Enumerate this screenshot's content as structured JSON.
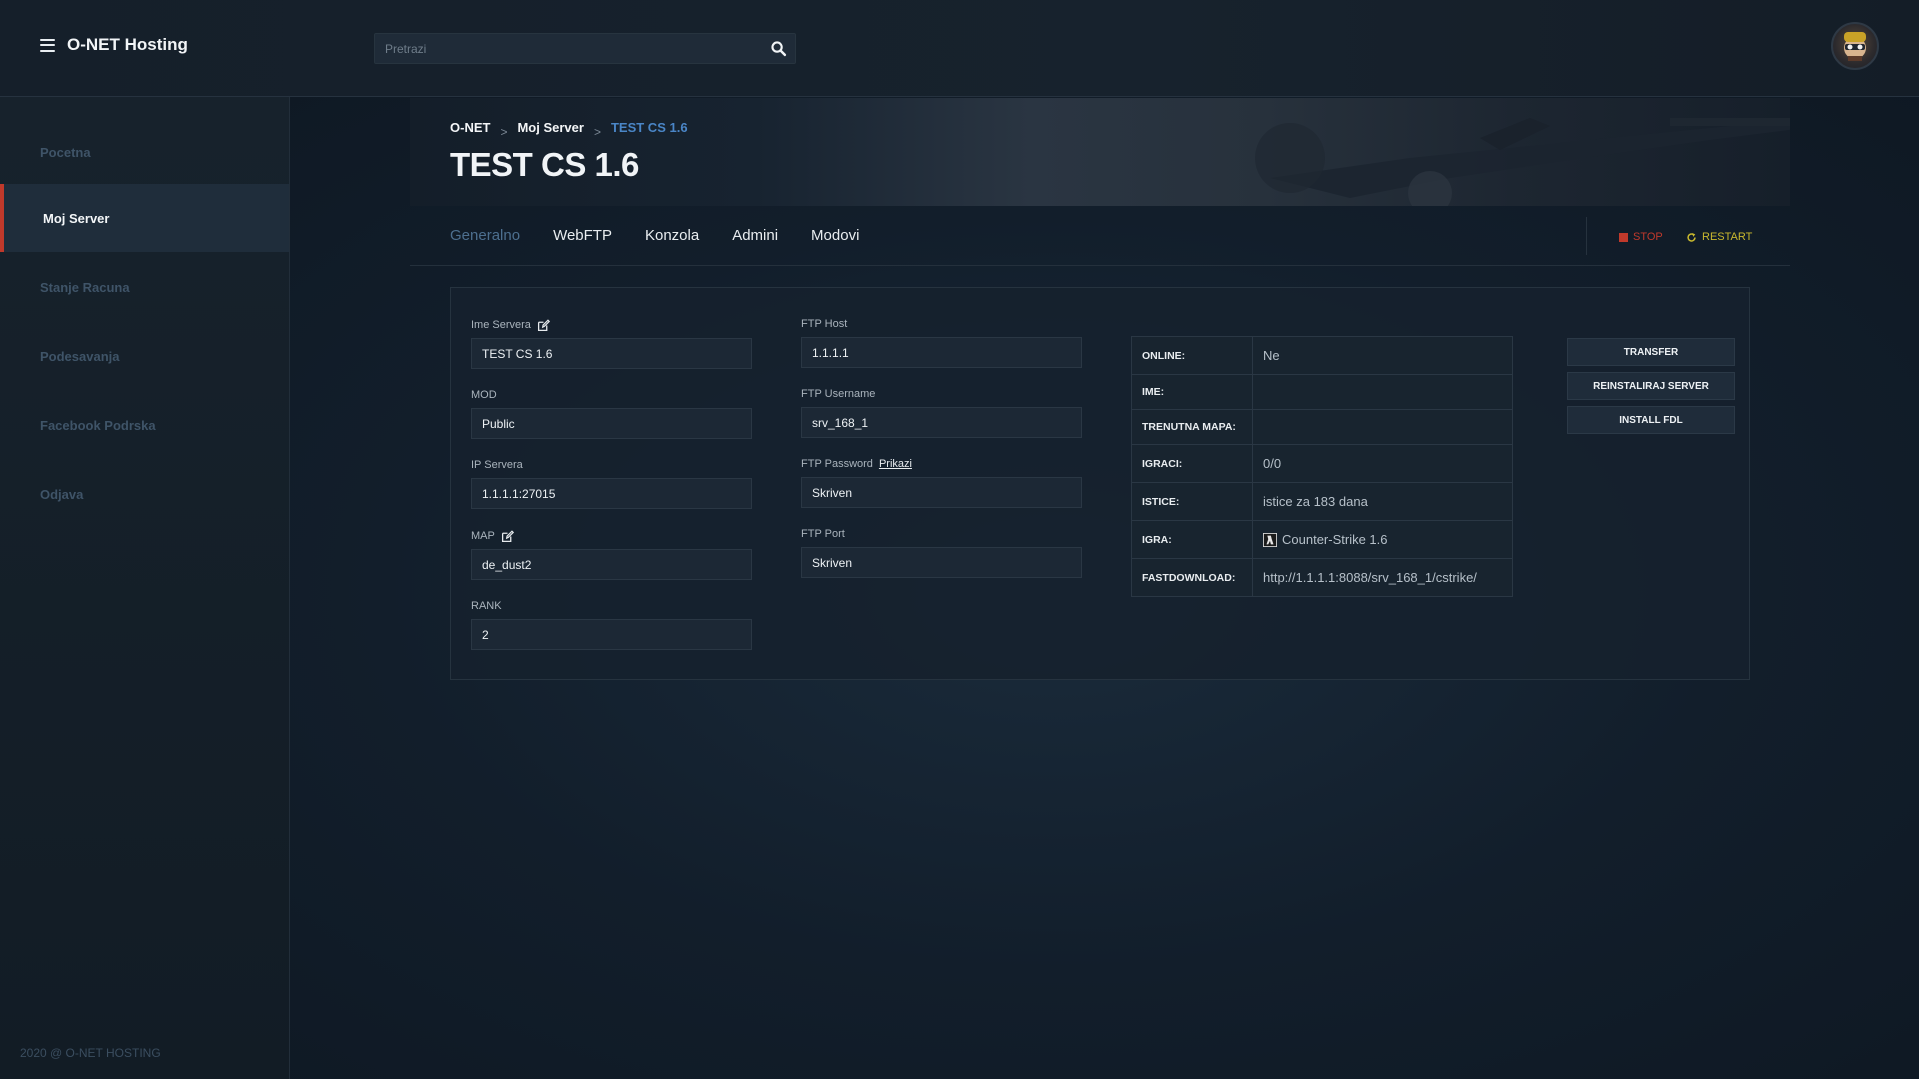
{
  "app": {
    "title": "O-NET Hosting"
  },
  "search": {
    "placeholder": "Pretrazi"
  },
  "sidebar": {
    "items": [
      {
        "label": "Pocetna"
      },
      {
        "label": "Moj Server"
      },
      {
        "label": "Stanje Racuna"
      },
      {
        "label": "Podesavanja"
      },
      {
        "label": "Facebook Podrska"
      },
      {
        "label": "Odjava"
      }
    ],
    "active_index": 1,
    "footer": "2020 @ O-NET HOSTING"
  },
  "breadcrumb": [
    "O-NET",
    "Moj Server",
    "TEST CS 1.6"
  ],
  "page": {
    "title": "TEST CS 1.6"
  },
  "tabs": [
    {
      "label": "Generalno"
    },
    {
      "label": "WebFTP"
    },
    {
      "label": "Konzola"
    },
    {
      "label": "Admini"
    },
    {
      "label": "Modovi"
    }
  ],
  "active_tab": 0,
  "actions": {
    "stop": "STOP",
    "restart": "RESTART"
  },
  "server": {
    "name_label": "Ime Servera",
    "name": "TEST CS 1.6",
    "mod_label": "MOD",
    "mod": "Public",
    "ip_label": "IP Servera",
    "ip": "1.1.1.1:27015",
    "map_label": "MAP",
    "map": "de_dust2",
    "rank_label": "RANK",
    "rank": "2"
  },
  "ftp": {
    "host_label": "FTP Host",
    "host": "1.1.1.1",
    "username_label": "FTP Username",
    "username": "srv_168_1",
    "password_label": "FTP Password",
    "password_link": "Prikazi",
    "password": "Skriven",
    "port_label": "FTP Port",
    "port": "Skriven"
  },
  "info": [
    {
      "key": "ONLINE:",
      "value": "Ne"
    },
    {
      "key": "IME:",
      "value": ""
    },
    {
      "key": "TRENUTNA MAPA:",
      "value": ""
    },
    {
      "key": "IGRACI:",
      "value": "0/0"
    },
    {
      "key": "ISTICE:",
      "value": "istice za 183 dana"
    },
    {
      "key": "IGRA:",
      "value": "Counter-Strike 1.6"
    },
    {
      "key": "FASTDOWNLOAD:",
      "value": "http://1.1.1.1:8088/srv_168_1/cstrike/"
    }
  ],
  "buttons": {
    "transfer": "TRANSFER",
    "reinstall": "REINSTALIRAJ SERVER",
    "install_fdl": "INSTALL FDL"
  },
  "colors": {
    "accent_red": "#c0392b",
    "accent_yellow": "#c9b92e",
    "link_blue": "#4a86c7",
    "active_tab": "#4d6f8f"
  },
  "icons": [
    "menu-icon",
    "search-icon",
    "avatar",
    "edit-icon",
    "stop-icon",
    "restart-icon",
    "game-icon"
  ]
}
